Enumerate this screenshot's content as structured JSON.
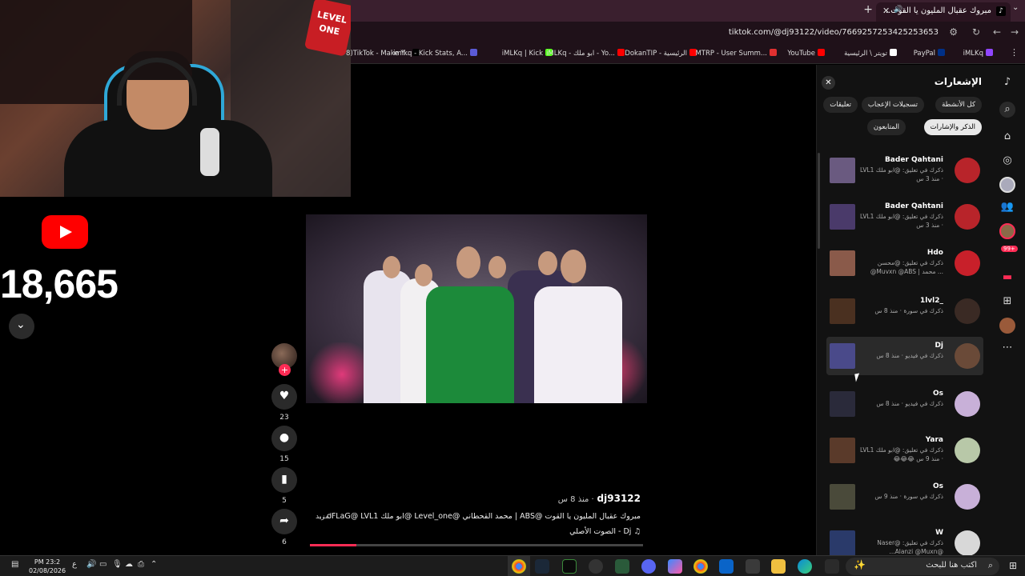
{
  "browser": {
    "tab_title": "مبروك عقبال المليون يا القوت...",
    "url": "tiktok.com/@dj93122/video/7669257253425253653",
    "bookmarks": [
      {
        "label": "8)TikTok - Make Y...",
        "color": "#000000"
      },
      {
        "label": "imlkq - Kick Stats, A...",
        "color": "#5b5bd6"
      },
      {
        "label": "iMLKq | Kick",
        "color": "#53fc18"
      },
      {
        "label": "iMLKq - ابو ملك - Yo...",
        "color": "#ff0000"
      },
      {
        "label": "DokanTIP - الرئيسية",
        "color": "#ff0000"
      },
      {
        "label": "MTRP - User Summ...",
        "color": "#e03030"
      },
      {
        "label": "YouTube",
        "color": "#ff0000"
      },
      {
        "label": "تويتر \\ الرئيسية",
        "color": "#ffffff"
      },
      {
        "label": "PayPal",
        "color": "#003087"
      },
      {
        "label": "iMLKq",
        "color": "#9146ff"
      }
    ]
  },
  "webcam": {
    "logo_text": "level one"
  },
  "yt_counter": {
    "count": "18,665"
  },
  "video": {
    "username": "dj93122",
    "time": "منذ 8 س",
    "caption": "مبروك عقبال المليون يا القوت @ABS | محمد القحطاني @Level_one @ابو ملك oFLaG@ LVL1 ...",
    "more": "المزيد",
    "sound": "Dj - الصوت الأصلي",
    "progress": 0.14,
    "actions": {
      "likes": "23",
      "comments": "15",
      "saves": "5",
      "shares": "6"
    }
  },
  "panel": {
    "title": "الإشعارات",
    "chips": [
      "كل الأنشطة",
      "تسجيلات الإعجاب",
      "تعليقات",
      "الذكر والإشارات",
      "المتابعون"
    ],
    "active_chip": "الذكر والإشارات",
    "notifications": [
      {
        "name": "Bader Qahtani",
        "line1": "ذكرك في تعليق: @ابو ملك LVL1",
        "line2": "· منذ 3 س",
        "av": "#b8242a",
        "th": "#6a5a80"
      },
      {
        "name": "Bader Qahtani",
        "line1": "ذكرك في تعليق: @ابو ملك LVL1",
        "line2": "· منذ 3 س",
        "av": "#b8242a",
        "th": "#4a3a6a"
      },
      {
        "name": "Hdo",
        "line1": "ذكرك في تعليق: @محسن",
        "line2": "... محمد | Muvxn @ABS@",
        "av": "#c8202a",
        "th": "#8a5a4a"
      },
      {
        "name": "_1lvl2",
        "line1": "ذكرك في سورة · منذ 8 س",
        "line2": "",
        "av": "#3a2a24",
        "th": "#4a3020"
      },
      {
        "name": "Dj",
        "line1": "ذكرك في فيديو · منذ 8 س",
        "line2": "",
        "av": "#6a4a38",
        "th": "#4a4a8a"
      },
      {
        "name": "Os",
        "line1": "ذكرك في فيديو · منذ 8 س",
        "line2": "",
        "av": "#c8b0d8",
        "th": "#2a2a3a"
      },
      {
        "name": "Yara",
        "line1": "ذكرك في تعليق: @ابو ملك LVL1",
        "line2": "· منذ 9 س 😂😂😂",
        "av": "#b8c8a8",
        "th": "#5a3a2a"
      },
      {
        "name": "Os",
        "line1": "ذكرك في سورة · منذ 9 س",
        "line2": "",
        "av": "#c8b0d8",
        "th": "#4a4a3a"
      },
      {
        "name": "W",
        "line1": "ذكرك في تعليق: @Naser",
        "line2": "@Alanzi @Muxn...",
        "av": "#d8d8d8",
        "th": "#2a3a6a"
      }
    ]
  },
  "sidenav": {
    "badge": "99+"
  },
  "taskbar": {
    "search_placeholder": "اكتب هنا للبحث",
    "time": "PM 23:2",
    "date": "02/08/2026",
    "lang": "ع"
  }
}
